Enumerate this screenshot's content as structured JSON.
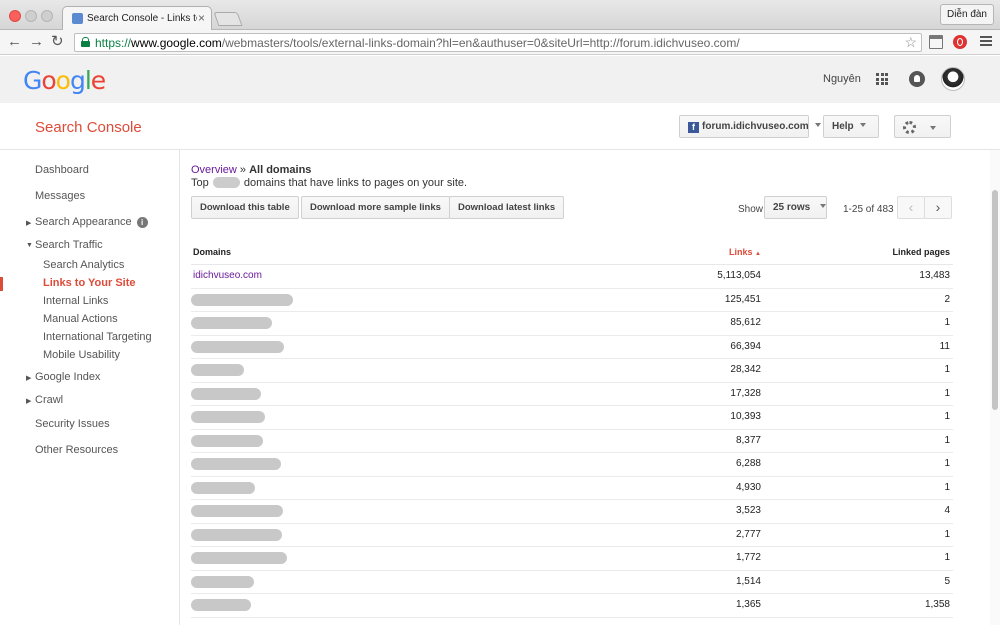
{
  "browser": {
    "tab_title": "Search Console - Links to",
    "tab_close": "×",
    "profile_name": "Diễn đàn",
    "url": {
      "scheme": "https://",
      "host": "www.google.com",
      "path": "/webmasters/tools/external-links-domain?hl=en&authuser=0&siteUrl=http://forum.idichvuseo.com/"
    },
    "nav": {
      "back": "←",
      "forward": "→",
      "reload": "↻"
    },
    "bookmark_star": "☆"
  },
  "google_header": {
    "logo_letters": [
      "G",
      "o",
      "o",
      "g",
      "l",
      "e"
    ],
    "user_name": "Nguyên"
  },
  "product_bar": {
    "title": "Search Console",
    "site_label": "forum.idichvuseo.com",
    "facebook_glyph": "f",
    "help_label": "Help"
  },
  "sidebar": {
    "dashboard": "Dashboard",
    "messages": "Messages",
    "search_appearance": "Search Appearance",
    "info_glyph": "i",
    "search_traffic": "Search Traffic",
    "search_traffic_items": [
      "Search Analytics",
      "Links to Your Site",
      "Internal Links",
      "Manual Actions",
      "International Targeting",
      "Mobile Usability"
    ],
    "google_index": "Google Index",
    "crawl": "Crawl",
    "security_issues": "Security Issues",
    "other_resources": "Other Resources",
    "arrow_collapsed": "▶",
    "arrow_expanded": "▼"
  },
  "main": {
    "breadcrumb_link": "Overview",
    "breadcrumb_sep": " » ",
    "breadcrumb_current": "All domains",
    "subtitle_before": "Top",
    "subtitle_after": "domains that have links to pages on your site.",
    "buttons": {
      "download_table": "Download this table",
      "download_more": "Download more sample links",
      "download_latest": "Download latest links"
    },
    "show_label": "Show",
    "rows_selected": "25 rows",
    "page_info": "1-25 of 483",
    "prev": "‹",
    "next": "›"
  },
  "table": {
    "headers": {
      "domains": "Domains",
      "links": "Links",
      "sort_arrow": "▲",
      "linked_pages": "Linked pages"
    },
    "rows": [
      {
        "domain": "idichvuseo.com",
        "redacted": false,
        "links": "5,113,054",
        "pages": "13,483"
      },
      {
        "domain": "",
        "redacted": true,
        "links": "125,451",
        "pages": "2"
      },
      {
        "domain": "",
        "redacted": true,
        "links": "85,612",
        "pages": "1"
      },
      {
        "domain": "",
        "redacted": true,
        "links": "66,394",
        "pages": "11"
      },
      {
        "domain": "",
        "redacted": true,
        "links": "28,342",
        "pages": "1"
      },
      {
        "domain": "",
        "redacted": true,
        "links": "17,328",
        "pages": "1"
      },
      {
        "domain": "",
        "redacted": true,
        "links": "10,393",
        "pages": "1"
      },
      {
        "domain": "",
        "redacted": true,
        "links": "8,377",
        "pages": "1"
      },
      {
        "domain": "",
        "redacted": true,
        "links": "6,288",
        "pages": "1"
      },
      {
        "domain": "",
        "redacted": true,
        "links": "4,930",
        "pages": "1"
      },
      {
        "domain": "",
        "redacted": true,
        "links": "3,523",
        "pages": "4"
      },
      {
        "domain": "",
        "redacted": true,
        "links": "2,777",
        "pages": "1"
      },
      {
        "domain": "",
        "redacted": true,
        "links": "1,772",
        "pages": "1"
      },
      {
        "domain": "",
        "redacted": true,
        "links": "1,514",
        "pages": "5"
      },
      {
        "domain": "",
        "redacted": true,
        "links": "1,365",
        "pages": "1,358"
      }
    ]
  }
}
